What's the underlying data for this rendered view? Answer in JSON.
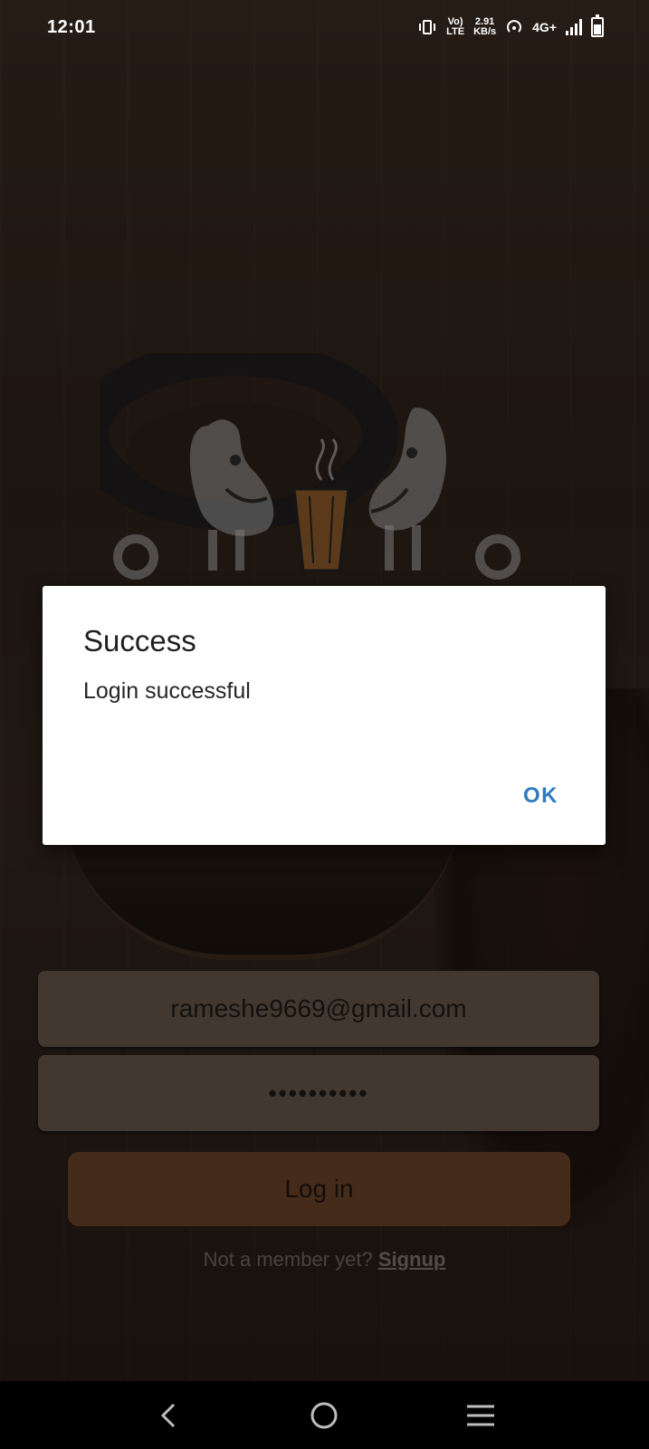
{
  "status_bar": {
    "time": "12:01",
    "volte": "Vo)",
    "lte": "LTE",
    "speed_value": "2.91",
    "speed_unit": "KB/s",
    "network": "4G+"
  },
  "form": {
    "email_value": "rameshe9669@gmail.com",
    "password_masked": "••••••••••",
    "login_label": "Log in",
    "signup_prompt": "Not a member yet?",
    "signup_link": "Signup"
  },
  "dialog": {
    "title": "Success",
    "message": "Login successful",
    "ok_label": "OK"
  },
  "icons": {
    "back": "back-icon",
    "home": "home-icon",
    "recents": "menu-icon"
  },
  "colors": {
    "dialog_accent": "#2e7bbf",
    "login_button": "#6a4328",
    "field_bg": "#66574a"
  }
}
